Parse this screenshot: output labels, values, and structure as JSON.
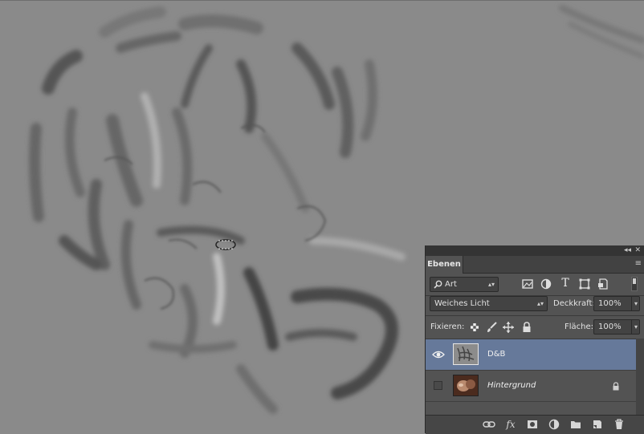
{
  "panel": {
    "collapse_glyph": "◂◂",
    "close_glyph": "✕",
    "tab_label": "Ebenen",
    "panel_menu_glyph": "≡",
    "filter": {
      "search_icon": "search-icon",
      "value": "Art",
      "filter_icons": [
        "image-filter-icon",
        "adjustment-filter-icon",
        "type-filter-icon",
        "shape-filter-icon",
        "smart-object-filter-icon"
      ],
      "type_glyph": "T"
    },
    "blend_mode": "Weiches Licht",
    "opacity_label": "Deckkraft:",
    "opacity_value": "100%",
    "lock_label": "Fixieren:",
    "fill_label": "Fläche:",
    "fill_value": "100%",
    "layers": [
      {
        "name": "D&B",
        "visible": true,
        "selected": true,
        "locked": false
      },
      {
        "name": "Hintergrund",
        "visible": false,
        "selected": false,
        "locked": true
      }
    ],
    "footer": {
      "link_icon": "link-icon",
      "fx_label": "fx",
      "mask_icon": "mask-icon",
      "adjustment_icon": "adjustment-layer-icon",
      "group_icon": "folder-icon",
      "new_layer_icon": "new-layer-icon",
      "delete_icon": "trash-icon"
    }
  },
  "colors": {
    "canvas_bg": "#8a8a8a",
    "panel_bg": "#535353",
    "selected_layer": "#66799a"
  }
}
